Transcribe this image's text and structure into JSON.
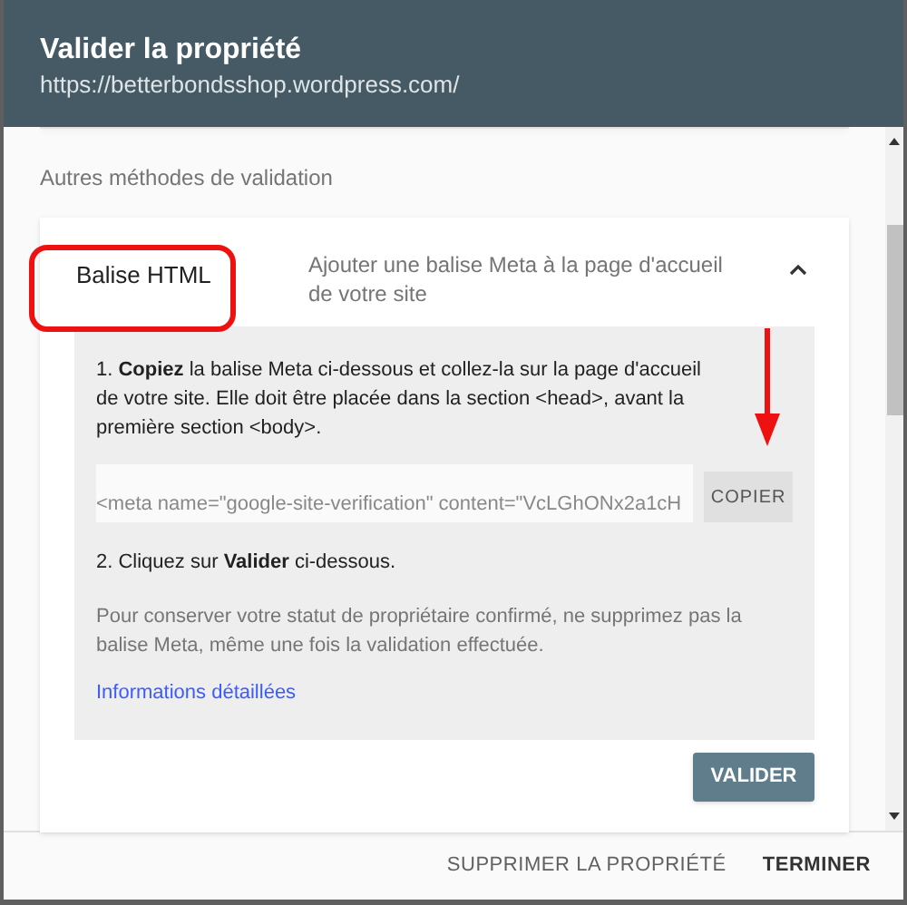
{
  "dialog": {
    "title": "Valider la propriété",
    "subtitle": "https://betterbondsshop.wordpress.com/"
  },
  "section_label": "Autres méthodes de validation",
  "method": {
    "name": "Balise HTML",
    "description": "Ajouter une balise Meta à la page d'accueil de votre site",
    "expanded": true,
    "step_1": "1. **Copiez** la balise Meta ci-dessous et collez-la sur la page d'accueil de votre site. Elle doit être placée dans la section <head>, avant la première section <body>.",
    "meta_tag": "<meta name=\"google-site-verification\" content=\"VcLGhONx2a1cH",
    "copy_button": "COPIER",
    "step_2": "2. Cliquez sur **Valider** ci-dessous.",
    "note": "Pour conserver votre statut de propriétaire confirmé, ne supprimez pas la balise Meta, même une fois la validation effectuée.",
    "link": "Informations détaillées",
    "validate_button": "VALIDER"
  },
  "footer_buttons": [
    "SUPPRIMER LA PROPRIÉTÉ",
    "TERMINER"
  ]
}
